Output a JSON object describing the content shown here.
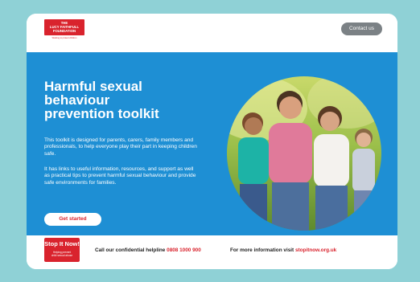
{
  "header": {
    "logo_text": "THE\nLUCY FAITHFULL\nFOUNDATION",
    "logo_tagline": "Working to protect children",
    "contact_label": "Contact us"
  },
  "hero": {
    "title": "Harmful sexual behaviour prevention toolkit",
    "paragraph_1": "This toolkit is designed for parents, carers, family members and professionals, to help everyone play their part in keeping children safe.",
    "paragraph_2": "It has links to useful information, resources, and support as well as practical tips to prevent harmful sexual behaviour and provide safe environments for families.",
    "cta_label": "Get started",
    "photo_icon": "family-photo"
  },
  "footer": {
    "logo_title": "Stop It Now!",
    "logo_sub": "Helping prevent\nchild sexual abuse",
    "helpline_text": "Call our confidential helpline",
    "helpline_number": "0808 1000 900",
    "info_text": "For more information visit",
    "info_link": "stopitnow.org.uk"
  },
  "colors": {
    "background": "#8fd1d6",
    "hero": "#1e8fd4",
    "brand_red": "#d9232d",
    "contact_button": "#7b8185"
  }
}
